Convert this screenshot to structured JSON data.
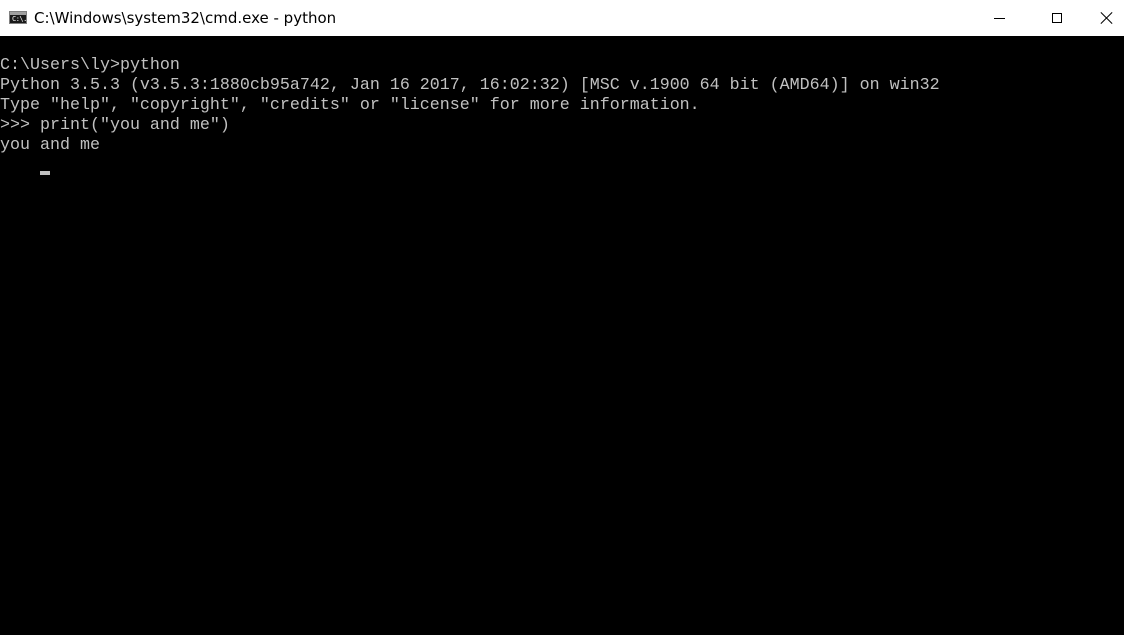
{
  "window": {
    "title": "C:\\Windows\\system32\\cmd.exe - python",
    "icon_label": "C:\\.",
    "buttons": {
      "minimize": "minimize-icon",
      "maximize": "maximize-icon",
      "close": "close-icon"
    }
  },
  "console": {
    "lines": [
      "C:\\Users\\ly>python",
      "Python 3.5.3 (v3.5.3:1880cb95a742, Jan 16 2017, 16:02:32) [MSC v.1900 64 bit (AMD64)] on win32",
      "Type \"help\", \"copyright\", \"credits\" or \"license\" for more information.",
      ">>> print(\"you and me\")",
      "you and me"
    ],
    "current_prompt": ">>> "
  },
  "colors": {
    "background": "#000000",
    "text": "#c0c0c0",
    "titlebar": "#ffffff"
  }
}
